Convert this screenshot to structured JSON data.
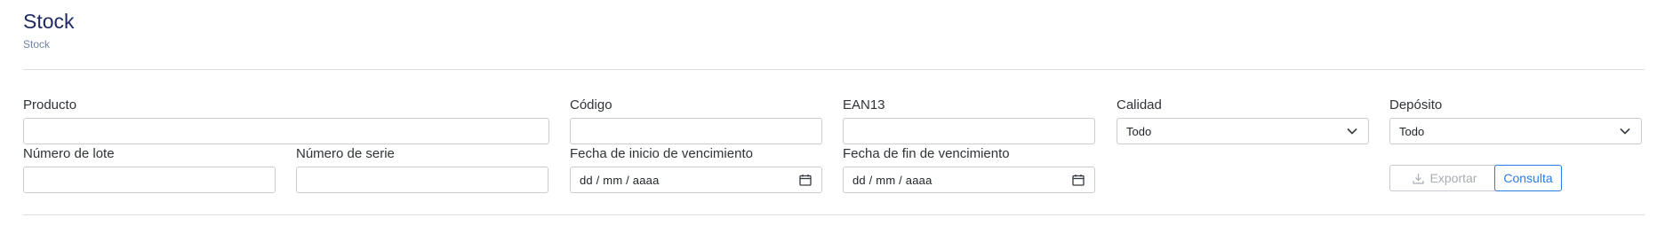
{
  "header": {
    "title": "Stock",
    "breadcrumb": "Stock"
  },
  "filters": {
    "producto": {
      "label": "Producto",
      "value": ""
    },
    "codigo": {
      "label": "Código",
      "value": ""
    },
    "ean13": {
      "label": "EAN13",
      "value": ""
    },
    "calidad": {
      "label": "Calidad",
      "selected": "Todo"
    },
    "deposito": {
      "label": "Depósito",
      "selected": "Todo"
    },
    "numero_lote": {
      "label": "Número de lote",
      "value": ""
    },
    "numero_serie": {
      "label": "Número de serie",
      "value": ""
    },
    "fecha_inicio": {
      "label": "Fecha de inicio de vencimiento",
      "placeholder": "dd / mm / aaaa"
    },
    "fecha_fin": {
      "label": "Fecha de fin de vencimiento",
      "placeholder": "dd / mm / aaaa"
    }
  },
  "actions": {
    "export_label": "Exportar",
    "consulta_label": "Consulta"
  },
  "icons": {
    "select": "chevron-down-icon",
    "date": "calendar-icon",
    "export": "download-icon"
  },
  "colors": {
    "title": "#1e2a63",
    "accent": "#2b7de9",
    "muted": "#a8adb3"
  }
}
